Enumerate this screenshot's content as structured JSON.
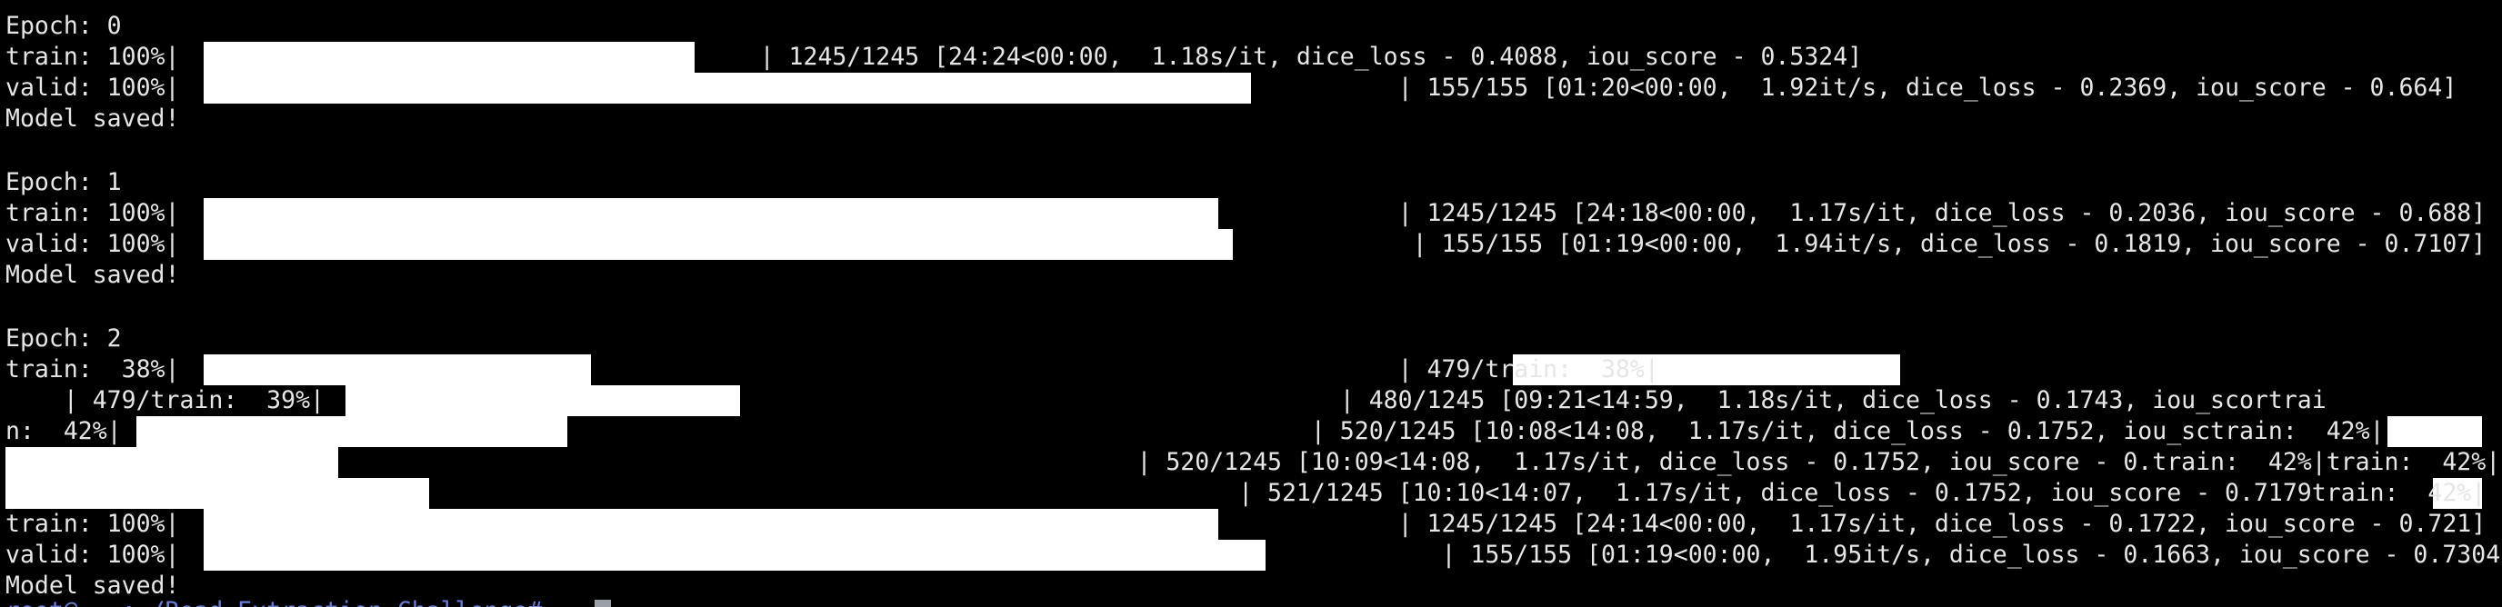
{
  "terminal": {
    "colors": {
      "background": "#000000",
      "text": "#e6e6e6",
      "bar": "#ffffff",
      "prompt": "#6b7bd6",
      "cursor": "#9aa0a6"
    },
    "lines": [
      "Epoch: 0",
      "train: 100%|                                        | 1245/1245 [24:24<00:00,  1.18s/it, dice_loss - 0.4088, iou_score - 0.5324]",
      "valid: 100%|                                                                                    | 155/155 [01:20<00:00,  1.92it/s, dice_loss - 0.2369, iou_score - 0.664]",
      "Model saved!",
      "",
      "Epoch: 1",
      "train: 100%|                                                                                    | 1245/1245 [24:18<00:00,  1.17s/it, dice_loss - 0.2036, iou_score - 0.688]",
      "valid: 100%|                                                                                     | 155/155 [01:19<00:00,  1.94it/s, dice_loss - 0.1819, iou_score - 0.7107]",
      "Model saved!",
      "",
      "Epoch: 2",
      "train:  38%|                                                                                    | 479/train:  38%|                                ",
      "    | 479/train:  39%|                                                                      | 480/1245 [09:21<14:59,  1.18s/it, dice_loss - 0.1743, iou_scortrai",
      "n:  42%|                                                                                  | 520/1245 [10:08<14:08,  1.17s/it, dice_loss - 0.1752, iou_sctrain:  42%|        ",
      "                                                                              | 520/1245 [10:09<14:08,  1.17s/it, dice_loss - 0.1752, iou_score - 0.train:  42%|train:  42%|    ",
      "                                                                                     | 521/1245 [10:10<14:07,  1.17s/it, dice_loss - 0.1752, iou_score - 0.7179train:  42%|    ",
      "train: 100%|                                                                                    | 1245/1245 [24:14<00:00,  1.17s/it, dice_loss - 0.1722, iou_score - 0.721]",
      "valid: 100%|                                                                                       | 155/155 [01:19<00:00,  1.95it/s, dice_loss - 0.1663, iou_score - 0.7304]",
      "Model saved!"
    ],
    "prompt_partial": "root@...:~/Road_Extraction_Challenge# "
  }
}
